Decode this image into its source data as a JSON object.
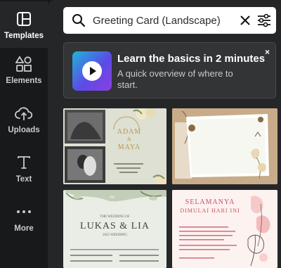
{
  "sidebar": {
    "items": [
      {
        "label": "Templates",
        "icon": "templates-icon",
        "active": true
      },
      {
        "label": "Elements",
        "icon": "elements-icon",
        "active": false
      },
      {
        "label": "Uploads",
        "icon": "upload-cloud-icon",
        "active": false
      },
      {
        "label": "Text",
        "icon": "text-icon",
        "active": false
      },
      {
        "label": "More",
        "icon": "more-dots-icon",
        "active": false
      }
    ]
  },
  "search": {
    "value": "Greeting Card (Landscape)"
  },
  "promo": {
    "title": "Learn the basics in 2 minutes",
    "description": "A quick overview of where to start.",
    "close": "×"
  },
  "templates": [
    {
      "id": "wedding-adam-maya",
      "line1": "ADAM",
      "amp": "&",
      "line2": "MAYA"
    },
    {
      "id": "scrapbook-paper"
    },
    {
      "id": "wedding-lukas-lia",
      "small": "THE WEDDING OF",
      "names": "LUKAS & LIA",
      "date": "2025 WEDDING"
    },
    {
      "id": "selamanya",
      "line1": "SELAMANYA",
      "line2": "DIMULAI HARI INI"
    }
  ],
  "colors": {
    "accent": "#8b3fe0",
    "rail_bg": "#18191b",
    "panel_bg": "#252627"
  }
}
